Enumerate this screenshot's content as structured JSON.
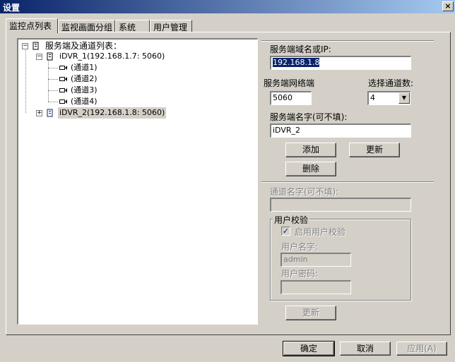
{
  "window": {
    "title": "设置",
    "close_glyph": "×"
  },
  "tabs": [
    {
      "label": "监控点列表",
      "active": true
    },
    {
      "label": "监视画面分组",
      "active": false
    },
    {
      "label": "系统",
      "active": false
    },
    {
      "label": "用户管理",
      "active": false
    }
  ],
  "tree": {
    "root_label": "服务端及通道列表：",
    "root_expander": "−",
    "servers": [
      {
        "label": "iDVR_1(192.168.1.7: 5060)",
        "expander": "−",
        "channels": [
          "(通道1)",
          "(通道2)",
          "(通道3)",
          "(通道4)"
        ]
      },
      {
        "label": "iDVR_2(192.168.1.8: 5060)",
        "expander": "+",
        "selected": true
      }
    ]
  },
  "server_form": {
    "host_label": "服务端域名或IP:",
    "host_value": "192.168.1.8",
    "port_label": "服务端网络端",
    "port_value": "5060",
    "channels_label": "选择通道数:",
    "channels_value": "4",
    "name_label": "服务端名字(可不填):",
    "name_value": "iDVR_2",
    "add_button": "添加",
    "update_button": "更新",
    "delete_button": "删除"
  },
  "channel_form": {
    "channel_name_label": "通道名字(可不填):",
    "channel_name_value": "",
    "user_group_title": "用户校验",
    "enable_check_label": "启用用户校验",
    "enable_check_checked": true,
    "username_label": "用户名字:",
    "username_value": "admin",
    "password_label": "用户密码:",
    "password_value": "",
    "update_button": "更新"
  },
  "footer": {
    "ok_button": "确定",
    "cancel_button": "取消",
    "apply_button": "应用(A)"
  }
}
